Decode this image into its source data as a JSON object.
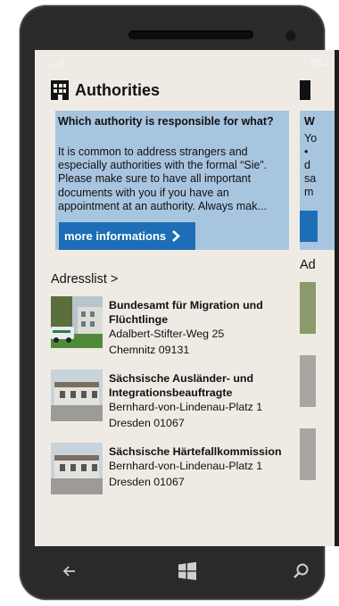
{
  "header": {
    "title": "Authorities",
    "icon": "building-icon"
  },
  "info_card": {
    "heading": "Which authority is responsible for what?",
    "body": "It is common to address strangers and especially authorities with the formal “Sie”. Please make sure to have all important documents with you if you have an appointment at an authority. Always mak...",
    "button_label": "more informations",
    "bg_color": "#a8c5e0",
    "button_color": "#1d6eb6"
  },
  "adress_list": {
    "heading": "Adresslist >",
    "items": [
      {
        "name": "Bundesamt für Migration und Flüchtlinge",
        "street": "Adalbert-Stifter-Weg  25",
        "city": "Chemnitz  09131"
      },
      {
        "name": "Sächsische Ausländer- und Integrationsbeauftragte",
        "street": "Bernhard-von-Lindenau-Platz  1",
        "city": "Dresden  01067"
      },
      {
        "name": "Sächsische Härtefallkommission",
        "street": "Bernhard-von-Lindenau-Platz  1",
        "city": "Dresden  01067"
      }
    ]
  },
  "peek": {
    "card_letters": [
      "W",
      "Yo",
      "•",
      "d",
      "sa",
      "m"
    ],
    "adress_prefix": "Ad"
  },
  "nav": {
    "back": "back-arrow-icon",
    "start": "windows-logo-icon",
    "search": "search-icon"
  }
}
